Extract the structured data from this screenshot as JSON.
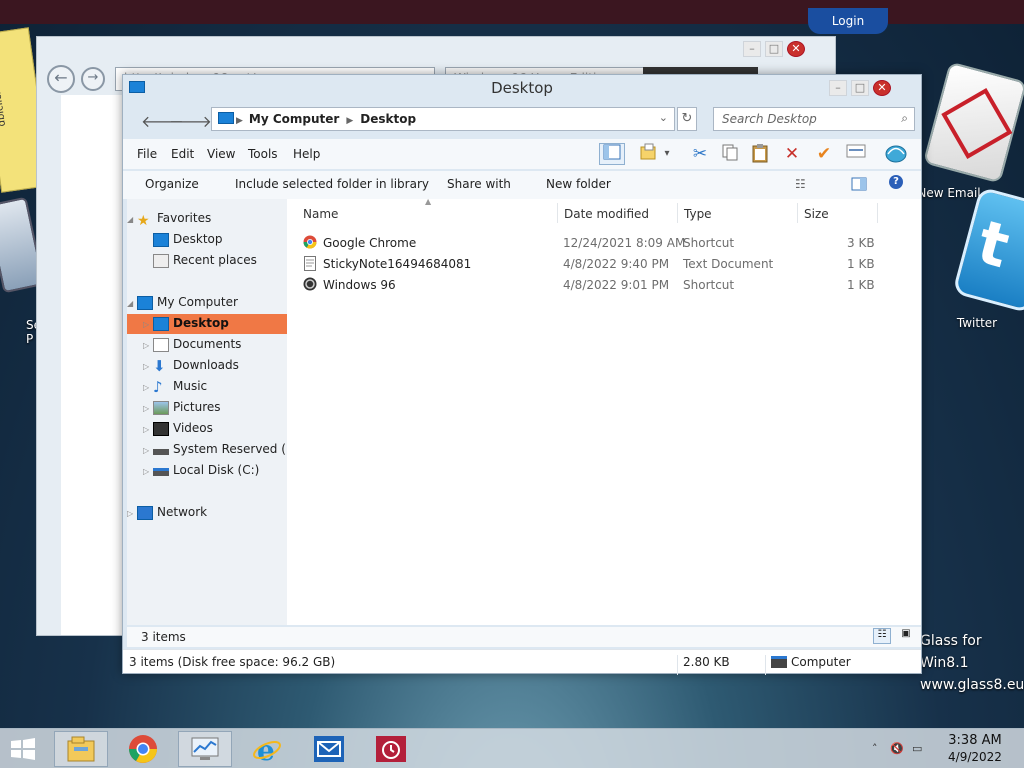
{
  "desktop": {
    "sticky_text": "dblclick to edit",
    "icons": [
      {
        "label": "New Email"
      },
      {
        "label": "Twitter"
      }
    ],
    "left_label": "Se\nP",
    "watermark_line1": "Glass for Win8.1",
    "watermark_line2": "www.glass8.eu",
    "login_label": "Login"
  },
  "browser_bg": {
    "url_text": "http://windows96.net/",
    "tab_text": "Windows 96 Home Edition"
  },
  "explorer": {
    "title": "Desktop",
    "address": {
      "segments": [
        "My Computer",
        "Desktop"
      ]
    },
    "search_placeholder": "Search Desktop",
    "menu": [
      "File",
      "Edit",
      "View",
      "Tools",
      "Help"
    ],
    "commands": [
      "Organize",
      "Include selected folder in library",
      "Share with",
      "New folder"
    ],
    "nav": {
      "favorites": {
        "label": "Favorites",
        "items": [
          "Desktop",
          "Recent places"
        ]
      },
      "computer": {
        "label": "My Computer",
        "items": [
          "Desktop",
          "Documents",
          "Downloads",
          "Music",
          "Pictures",
          "Videos",
          "System Reserved (B:)",
          "Local Disk (C:)"
        ]
      },
      "network": {
        "label": "Network"
      }
    },
    "columns": [
      "Name",
      "Date modified",
      "Type",
      "Size"
    ],
    "files": [
      {
        "name": "Google Chrome",
        "date": "12/24/2021 8:09 AM",
        "type": "Shortcut",
        "size": "3 KB",
        "icon": "chrome-icon"
      },
      {
        "name": "StickyNote16494684081",
        "date": "4/8/2022 9:40 PM",
        "type": "Text Document",
        "size": "1 KB",
        "icon": "text-file-icon"
      },
      {
        "name": "Windows 96",
        "date": "4/8/2022 9:01 PM",
        "type": "Shortcut",
        "size": "1 KB",
        "icon": "windows96-icon"
      }
    ],
    "status_items": "3 items",
    "details": {
      "summary": "3 items (Disk free space: 96.2 GB)",
      "size": "2.80 KB",
      "location": "Computer"
    }
  },
  "taskbar": {
    "time": "3:38 AM",
    "date": "4/9/2022"
  },
  "colors": {
    "selection": "#f07845",
    "accent": "#1b82d8"
  }
}
